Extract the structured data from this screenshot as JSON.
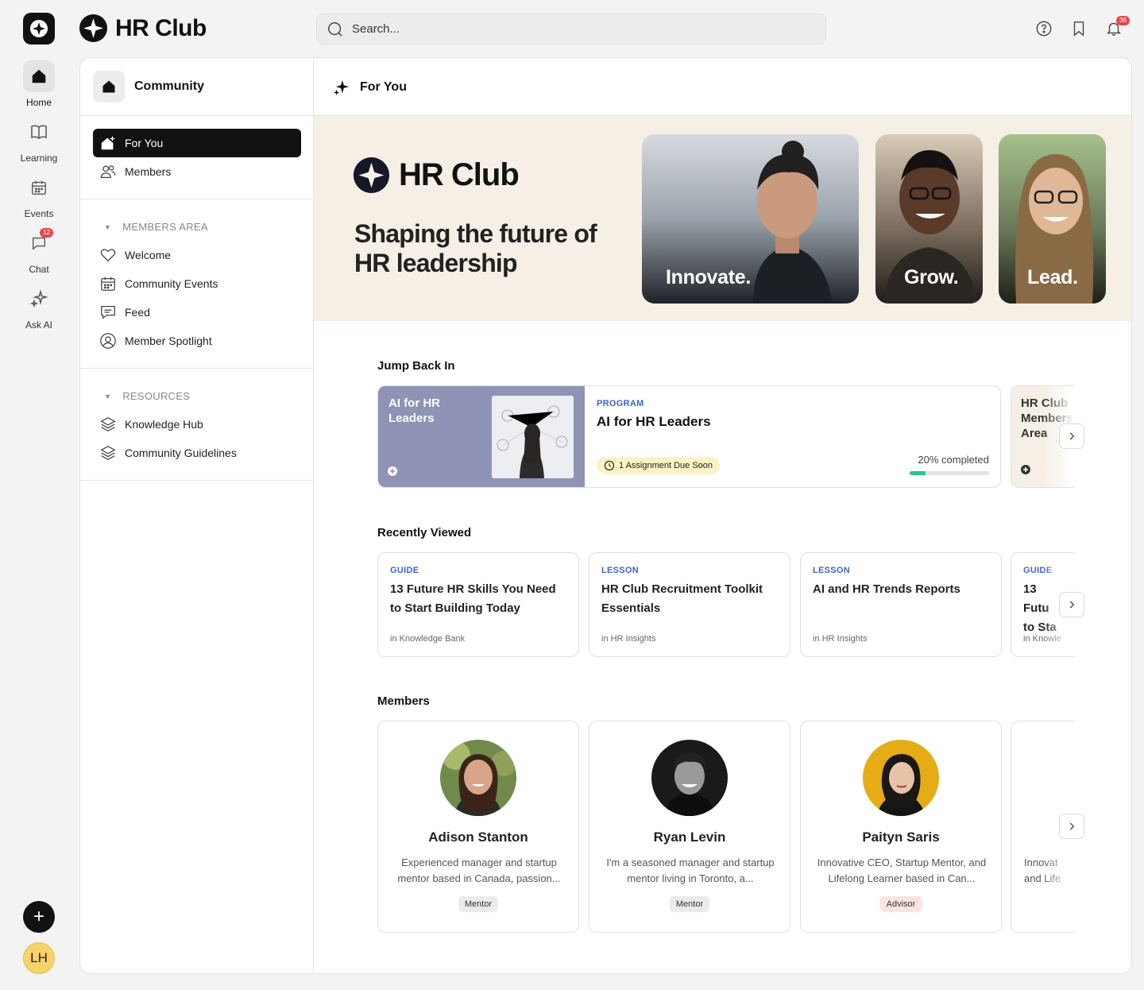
{
  "app": {
    "name": "HR Club"
  },
  "search": {
    "placeholder": "Search..."
  },
  "header": {
    "notification_count": "36"
  },
  "rail": {
    "items": [
      {
        "label": "Home",
        "icon": "home-icon"
      },
      {
        "label": "Learning",
        "icon": "book-icon"
      },
      {
        "label": "Events",
        "icon": "calendar-icon"
      },
      {
        "label": "Chat",
        "icon": "chat-icon",
        "badge": "12"
      },
      {
        "label": "Ask AI",
        "icon": "sparkle-icon"
      }
    ],
    "avatar_initials": "LH"
  },
  "sidebar": {
    "title": "Community",
    "top_items": [
      {
        "label": "For You",
        "icon": "sparkle-home-icon",
        "active": true
      },
      {
        "label": "Members",
        "icon": "members-icon"
      }
    ],
    "sections": [
      {
        "title": "MEMBERS AREA",
        "items": [
          {
            "label": "Welcome",
            "icon": "heart-icon"
          },
          {
            "label": "Community Events",
            "icon": "calendar-icon"
          },
          {
            "label": "Feed",
            "icon": "message-icon"
          },
          {
            "label": "Member Spotlight",
            "icon": "user-circle-icon"
          }
        ]
      },
      {
        "title": "RESOURCES",
        "items": [
          {
            "label": "Knowledge Hub",
            "icon": "layers-icon"
          },
          {
            "label": "Community Guidelines",
            "icon": "layers-icon"
          }
        ]
      }
    ]
  },
  "main": {
    "title": "For You",
    "hero": {
      "brand": "HR Club",
      "tagline": "Shaping the future of HR leadership",
      "cards": [
        "Innovate.",
        "Grow.",
        "Lead."
      ]
    },
    "jump_back_in": {
      "title": "Jump Back In",
      "card": {
        "thumb_title": "AI for HR Leaders",
        "kicker": "PROGRAM",
        "title": "AI for HR Leaders",
        "due": "1 Assignment Due Soon",
        "progress_text": "20% completed",
        "progress": 0.2
      },
      "peek_title": "HR Club Members Area"
    },
    "recently_viewed": {
      "title": "Recently Viewed",
      "items": [
        {
          "kicker": "GUIDE",
          "title": "13 Future HR Skills You Need to Start Building Today",
          "sub": "in Knowledge Bank"
        },
        {
          "kicker": "LESSON",
          "title": "HR Club Recruitment Toolkit Essentials",
          "sub": "in HR Insights"
        },
        {
          "kicker": "LESSON",
          "title": "AI and HR Trends Reports",
          "sub": "in HR Insights"
        }
      ],
      "peek": {
        "kicker": "GUIDE",
        "title": "13 Futu to Sta",
        "sub": "in Knowle"
      }
    },
    "members": {
      "title": "Members",
      "items": [
        {
          "name": "Adison Stanton",
          "bio": "Experienced manager and startup mentor based in Canada, passion...",
          "tag": "Mentor"
        },
        {
          "name": "Ryan Levin",
          "bio": "I'm a seasoned manager and startup mentor living in Toronto, a...",
          "tag": "Mentor"
        },
        {
          "name": "Paityn Saris",
          "bio": "Innovative CEO, Startup Mentor, and Lifelong Learner based in Can...",
          "tag": "Advisor"
        }
      ],
      "peek_bio": "Innovat and Life"
    }
  },
  "colors": {
    "accent_blue": "#3f63c9",
    "progress": "#22c98a",
    "badge_red": "#e5484d",
    "hero_bg": "#f5efe6"
  }
}
